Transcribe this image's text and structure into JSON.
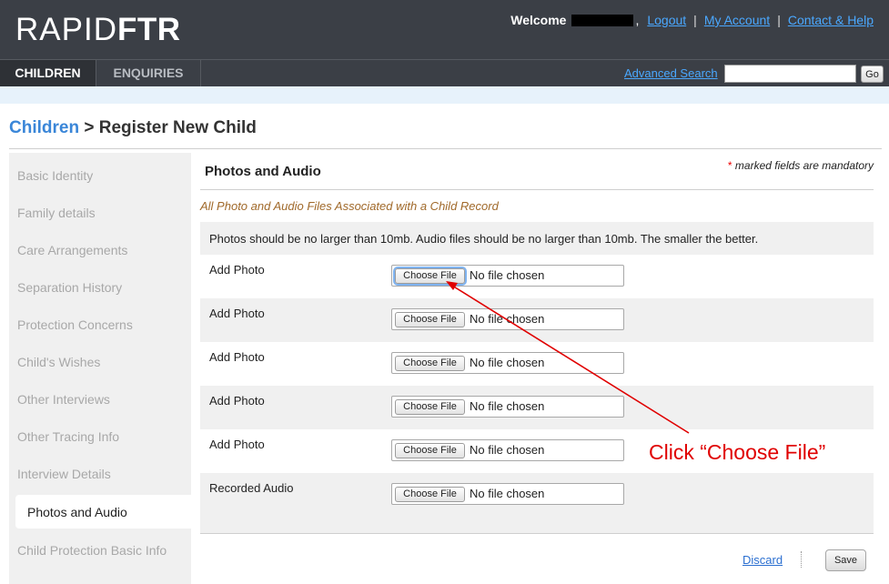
{
  "app": {
    "logo_light": "RAPID",
    "logo_bold": "FTR"
  },
  "userbar": {
    "welcome": "Welcome",
    "logout": "Logout",
    "my_account": "My Account",
    "contact_help": "Contact & Help",
    "separator": "|"
  },
  "nav": {
    "tabs": [
      {
        "label": "CHILDREN",
        "active": true
      },
      {
        "label": "ENQUIRIES",
        "active": false
      }
    ],
    "advanced_search": "Advanced Search",
    "search_value": "",
    "go_label": "Go"
  },
  "breadcrumb": {
    "parent": "Children",
    "separator": " > ",
    "current": "Register New Child"
  },
  "sidebar": {
    "items": [
      {
        "label": "Basic Identity"
      },
      {
        "label": "Family details"
      },
      {
        "label": "Care Arrangements"
      },
      {
        "label": "Separation History"
      },
      {
        "label": "Protection Concerns"
      },
      {
        "label": "Child's Wishes"
      },
      {
        "label": "Other Interviews"
      },
      {
        "label": "Other Tracing Info"
      },
      {
        "label": "Interview Details"
      },
      {
        "label": "Photos and Audio",
        "active": true
      },
      {
        "label": "Child Protection Basic Info"
      }
    ]
  },
  "section": {
    "title": "Photos and Audio",
    "mandatory_star": "*",
    "mandatory_text": " marked fields are mandatory",
    "subtitle": "All Photo and Audio Files Associated with a Child Record",
    "info": "Photos should be no larger than 10mb. Audio files should be no larger than 10mb. The smaller the better.",
    "rows": [
      {
        "label": "Add Photo",
        "button": "Choose File",
        "status": "No file chosen"
      },
      {
        "label": "Add Photo",
        "button": "Choose File",
        "status": "No file chosen"
      },
      {
        "label": "Add Photo",
        "button": "Choose File",
        "status": "No file chosen"
      },
      {
        "label": "Add Photo",
        "button": "Choose File",
        "status": "No file chosen"
      },
      {
        "label": "Add Photo",
        "button": "Choose File",
        "status": "No file chosen"
      },
      {
        "label": "Recorded Audio",
        "button": "Choose File",
        "status": "No file chosen"
      }
    ]
  },
  "actions": {
    "discard": "Discard",
    "save": "Save"
  },
  "annotation": {
    "text": "Click “Choose File”",
    "color": "#e00000"
  },
  "colors": {
    "header": "#3b3f46",
    "link": "#4aa8ff",
    "subtitle": "#a0692a"
  }
}
